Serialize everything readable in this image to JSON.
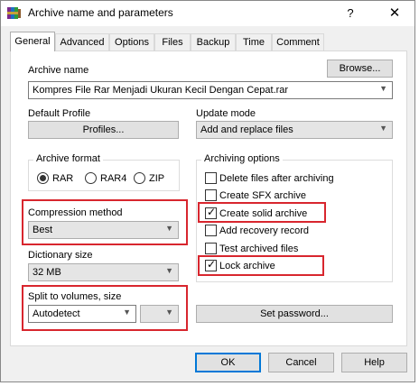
{
  "window": {
    "title": "Archive name and parameters",
    "help_glyph": "?",
    "close_glyph": "✕"
  },
  "tabs": [
    {
      "label": "General",
      "active": true
    },
    {
      "label": "Advanced"
    },
    {
      "label": "Options"
    },
    {
      "label": "Files"
    },
    {
      "label": "Backup"
    },
    {
      "label": "Time"
    },
    {
      "label": "Comment"
    }
  ],
  "archive_name": {
    "label": "Archive name",
    "browse_label": "Browse...",
    "value": "Kompres File Rar Menjadi Ukuran Kecil Dengan Cepat.rar"
  },
  "default_profile": {
    "label": "Default Profile",
    "button_label": "Profiles..."
  },
  "update_mode": {
    "label": "Update mode",
    "value": "Add and replace files"
  },
  "archive_format": {
    "label": "Archive format",
    "options": [
      {
        "label": "RAR",
        "selected": true
      },
      {
        "label": "RAR4",
        "selected": false
      },
      {
        "label": "ZIP",
        "selected": false
      }
    ]
  },
  "compression_method": {
    "label": "Compression method",
    "value": "Best"
  },
  "dictionary_size": {
    "label": "Dictionary size",
    "value": "32 MB"
  },
  "split_volumes": {
    "label": "Split to volumes, size",
    "value": "Autodetect",
    "unit_value": ""
  },
  "archiving_options": {
    "label": "Archiving options",
    "items": [
      {
        "label": "Delete files after archiving",
        "checked": false
      },
      {
        "label": "Create SFX archive",
        "checked": false
      },
      {
        "label": "Create solid archive",
        "checked": true
      },
      {
        "label": "Add recovery record",
        "checked": false
      },
      {
        "label": "Test archived files",
        "checked": false
      },
      {
        "label": "Lock archive",
        "checked": true
      }
    ]
  },
  "set_password_label": "Set password...",
  "footer": {
    "ok_label": "OK",
    "cancel_label": "Cancel",
    "help_label": "Help"
  },
  "colors": {
    "highlight": "#d8262e",
    "default_button_border": "#0078d7"
  },
  "icons": {
    "app": "winrar-books-icon",
    "dropdown": "chevron-down-icon",
    "check": "checkmark-icon"
  }
}
